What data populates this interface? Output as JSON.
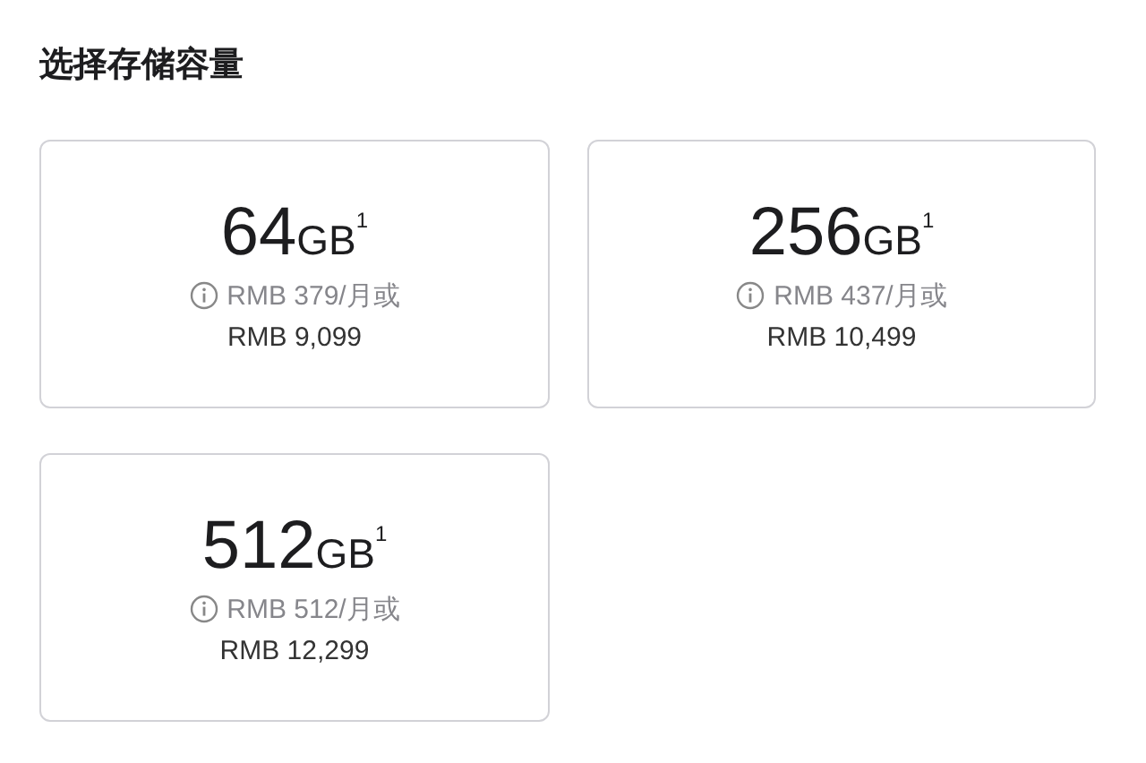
{
  "title": "选择存储容量",
  "options": [
    {
      "capacity": "64",
      "unit": "GB",
      "footnote": "1",
      "monthly": "RMB 379/月或",
      "price": "RMB 9,099",
      "selected": false
    },
    {
      "capacity": "256",
      "unit": "GB",
      "footnote": "1",
      "monthly": "RMB 437/月或",
      "price": "RMB 10,499",
      "selected": false
    },
    {
      "capacity": "512",
      "unit": "GB",
      "footnote": "1",
      "monthly": "RMB 512/月或",
      "price": "RMB 12,299",
      "selected": false
    }
  ]
}
